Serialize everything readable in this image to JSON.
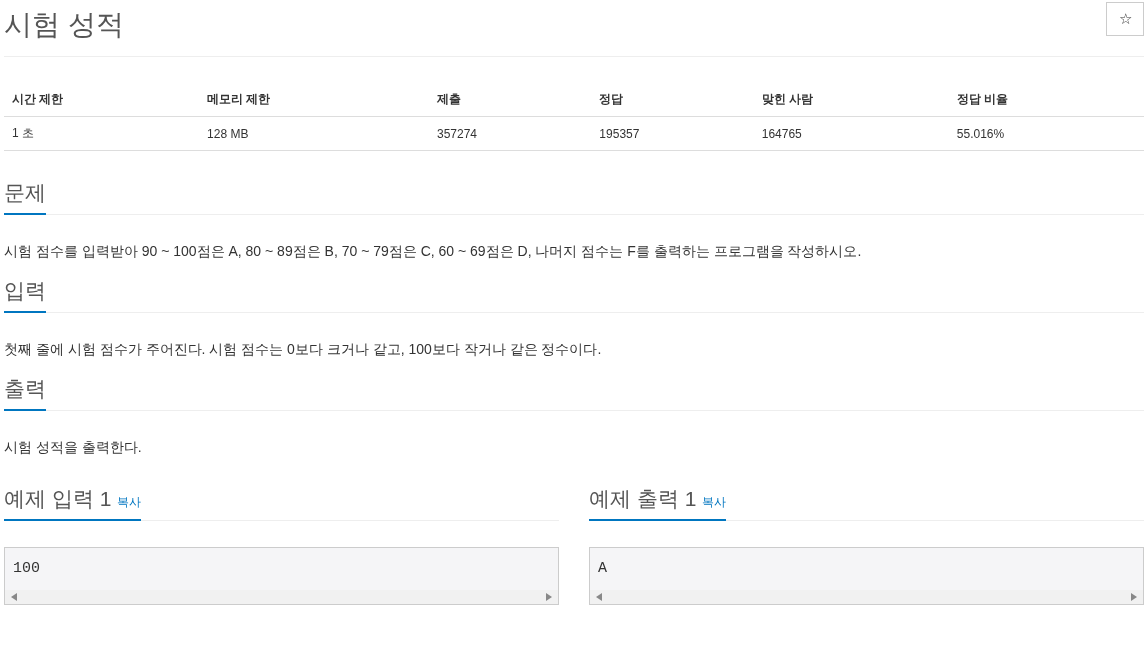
{
  "title": "시험 성적",
  "star_button": {
    "label": "☆"
  },
  "stats": {
    "columns": [
      "시간 제한",
      "메모리 제한",
      "제출",
      "정답",
      "맞힌 사람",
      "정답 비율"
    ],
    "rows": [
      [
        "1 초",
        "128 MB",
        "357274",
        "195357",
        "164765",
        "55.016%"
      ]
    ]
  },
  "sections": [
    {
      "heading": "문제",
      "body": "시험 점수를 입력받아 90 ~ 100점은 A, 80 ~ 89점은 B, 70 ~ 79점은 C, 60 ~ 69점은 D, 나머지 점수는 F를 출력하는 프로그램을 작성하시오."
    },
    {
      "heading": "입력",
      "body": "첫째 줄에 시험 점수가 주어진다. 시험 점수는 0보다 크거나 같고, 100보다 작거나 같은 정수이다."
    },
    {
      "heading": "출력",
      "body": "시험 성적을 출력한다."
    }
  ],
  "samples": [
    {
      "heading": "예제 입력 1",
      "copy": "복사",
      "content": "100"
    },
    {
      "heading": "예제 출력 1",
      "copy": "복사",
      "content": "A"
    }
  ]
}
